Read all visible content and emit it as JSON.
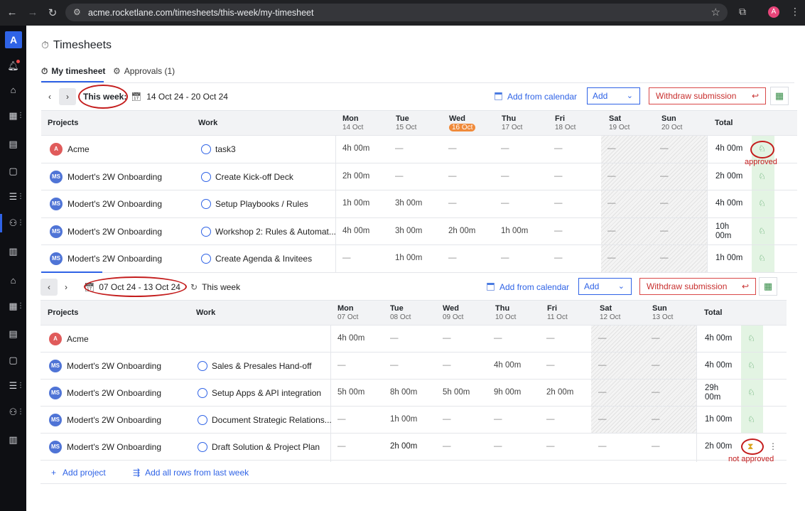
{
  "browser": {
    "url": "acme.rocketlane.com/timesheets/this-week/my-timesheet",
    "profile_initial": "A"
  },
  "rail": {
    "logo": "A"
  },
  "page": {
    "title": "Timesheets",
    "tabs": [
      {
        "label": "My timesheet",
        "active": true
      },
      {
        "label": "Approvals (1)",
        "active": false
      }
    ]
  },
  "week1": {
    "label": "This week:",
    "range": "14 Oct 24 - 20 Oct 24",
    "add_from_calendar": "Add from calendar",
    "add": "Add",
    "withdraw": "Withdraw submission",
    "headers": {
      "projects": "Projects",
      "work": "Work",
      "days": [
        {
          "name": "Mon",
          "date": "14 Oct"
        },
        {
          "name": "Tue",
          "date": "15 Oct"
        },
        {
          "name": "Wed",
          "date": "16 Oct",
          "today": true
        },
        {
          "name": "Thu",
          "date": "17 Oct"
        },
        {
          "name": "Fri",
          "date": "18 Oct"
        },
        {
          "name": "Sat",
          "date": "19 Oct"
        },
        {
          "name": "Sun",
          "date": "20 Oct"
        }
      ],
      "total": "Total"
    },
    "rows": [
      {
        "avatar": "A",
        "project": "Acme",
        "work": "task3",
        "days": [
          "4h 00m",
          "—",
          "—",
          "—",
          "—",
          "—",
          "—"
        ],
        "total": "4h 00m"
      },
      {
        "avatar": "MS",
        "project": "Modert's 2W Onboarding",
        "work": "Create Kick-off Deck",
        "days": [
          "2h 00m",
          "—",
          "—",
          "—",
          "—",
          "—",
          "—"
        ],
        "total": "2h 00m"
      },
      {
        "avatar": "MS",
        "project": "Modert's 2W Onboarding",
        "work": "Setup Playbooks / Rules",
        "days": [
          "1h 00m",
          "3h 00m",
          "—",
          "—",
          "—",
          "—",
          "—"
        ],
        "total": "4h 00m"
      },
      {
        "avatar": "MS",
        "project": "Modert's 2W Onboarding",
        "work": "Workshop 2: Rules & Automat...",
        "days": [
          "4h 00m",
          "3h 00m",
          "2h 00m",
          "1h 00m",
          "—",
          "—",
          "—"
        ],
        "total": "10h 00m"
      },
      {
        "avatar": "MS",
        "project": "Modert's 2W Onboarding",
        "work": "Create Agenda & Invitees",
        "days": [
          "—",
          "1h 00m",
          "—",
          "—",
          "—",
          "—",
          "—"
        ],
        "total": "1h 00m"
      }
    ],
    "annotation": "approved"
  },
  "week2": {
    "range": "07 Oct 24 - 13 Oct 24",
    "this_week": "This week",
    "add_from_calendar": "Add from calendar",
    "add": "Add",
    "withdraw": "Withdraw submission",
    "headers": {
      "projects": "Projects",
      "work": "Work",
      "days": [
        {
          "name": "Mon",
          "date": "07 Oct"
        },
        {
          "name": "Tue",
          "date": "08 Oct"
        },
        {
          "name": "Wed",
          "date": "09 Oct"
        },
        {
          "name": "Thu",
          "date": "10 Oct"
        },
        {
          "name": "Fri",
          "date": "11 Oct"
        },
        {
          "name": "Sat",
          "date": "12 Oct"
        },
        {
          "name": "Sun",
          "date": "13 Oct"
        }
      ],
      "total": "Total"
    },
    "rows": [
      {
        "avatar": "A",
        "project": "Acme",
        "work": "",
        "days": [
          "4h 00m",
          "—",
          "—",
          "—",
          "—",
          "—",
          "—"
        ],
        "total": "4h 00m"
      },
      {
        "avatar": "MS",
        "project": "Modert's 2W Onboarding",
        "work": "Sales & Presales Hand-off",
        "days": [
          "—",
          "—",
          "—",
          "4h 00m",
          "—",
          "—",
          "—"
        ],
        "total": "4h 00m"
      },
      {
        "avatar": "MS",
        "project": "Modert's 2W Onboarding",
        "work": "Setup Apps & API integration",
        "days": [
          "5h 00m",
          "8h 00m",
          "5h 00m",
          "9h 00m",
          "2h 00m",
          "—",
          "—"
        ],
        "total": "29h 00m"
      },
      {
        "avatar": "MS",
        "project": "Modert's 2W Onboarding",
        "work": "Document Strategic Relations...",
        "days": [
          "—",
          "1h 00m",
          "—",
          "—",
          "—",
          "—",
          "—"
        ],
        "total": "1h 00m"
      },
      {
        "avatar": "MS",
        "project": "Modert's 2W Onboarding",
        "work": "Draft Solution & Project Plan",
        "days": [
          "—",
          "2h 00m",
          "—",
          "—",
          "—",
          "—",
          "—"
        ],
        "total": "2h 00m"
      }
    ],
    "annotation": "not approved",
    "add_project": "Add project",
    "add_all_rows": "Add all rows from last week"
  }
}
